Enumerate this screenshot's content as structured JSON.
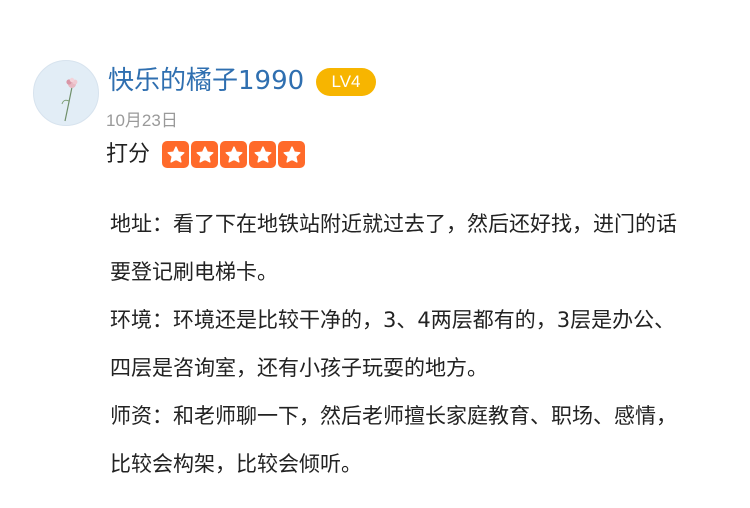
{
  "review": {
    "username": "快乐的橘子1990",
    "level": "LV4",
    "date": "10月23日",
    "rating_label": "打分",
    "rating": 5,
    "rating_max": 5,
    "paragraphs": [
      "地址：看了下在地铁站附近就过去了，然后还好找，进门的话要登记刷电梯卡。",
      "环境：环境还是比较干净的，3、4两层都有的，3层是办公、四层是咨询室，还有小孩子玩耍的地方。",
      "师资：和老师聊一下，然后老师擅长家庭教育、职场、感情，比较会构架，比较会倾听。"
    ]
  },
  "colors": {
    "username": "#2f6fb0",
    "level_badge": "#f7b500",
    "star": "#ff6a2a",
    "date": "#9a9a9a",
    "avatar_bg": "#e2edf6"
  },
  "icons": {
    "avatar": "flower-avatar-icon",
    "star": "star-icon"
  }
}
